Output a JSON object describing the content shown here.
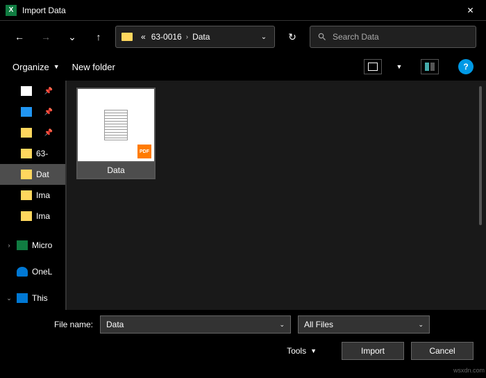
{
  "title": "Import Data",
  "breadcrumb": {
    "prefix": "«",
    "parent": "63-0016",
    "current": "Data"
  },
  "search_placeholder": "Search Data",
  "toolbar": {
    "organize": "Organize",
    "newfolder": "New folder"
  },
  "tree": [
    {
      "label": "",
      "icon": "doc",
      "pin": true
    },
    {
      "label": "",
      "icon": "img",
      "pin": true
    },
    {
      "label": "",
      "icon": "fold",
      "pin": true
    },
    {
      "label": "63-",
      "icon": "fold"
    },
    {
      "label": "Dat",
      "icon": "fold",
      "selected": true
    },
    {
      "label": "Ima",
      "icon": "fold"
    },
    {
      "label": "Ima",
      "icon": "fold"
    },
    {
      "label": "Micro",
      "icon": "excel",
      "root": true,
      "tw": "›"
    },
    {
      "label": "OneL",
      "icon": "cloud",
      "root": true
    },
    {
      "label": "This",
      "icon": "pc",
      "root": true,
      "tw": "⌄"
    }
  ],
  "files": [
    {
      "name": "Data",
      "badge": "PDF"
    }
  ],
  "footer": {
    "filename_label": "File name:",
    "filename_value": "Data",
    "filter": "All Files",
    "tools": "Tools",
    "import": "Import",
    "cancel": "Cancel"
  },
  "watermark": "wsxdn.com"
}
